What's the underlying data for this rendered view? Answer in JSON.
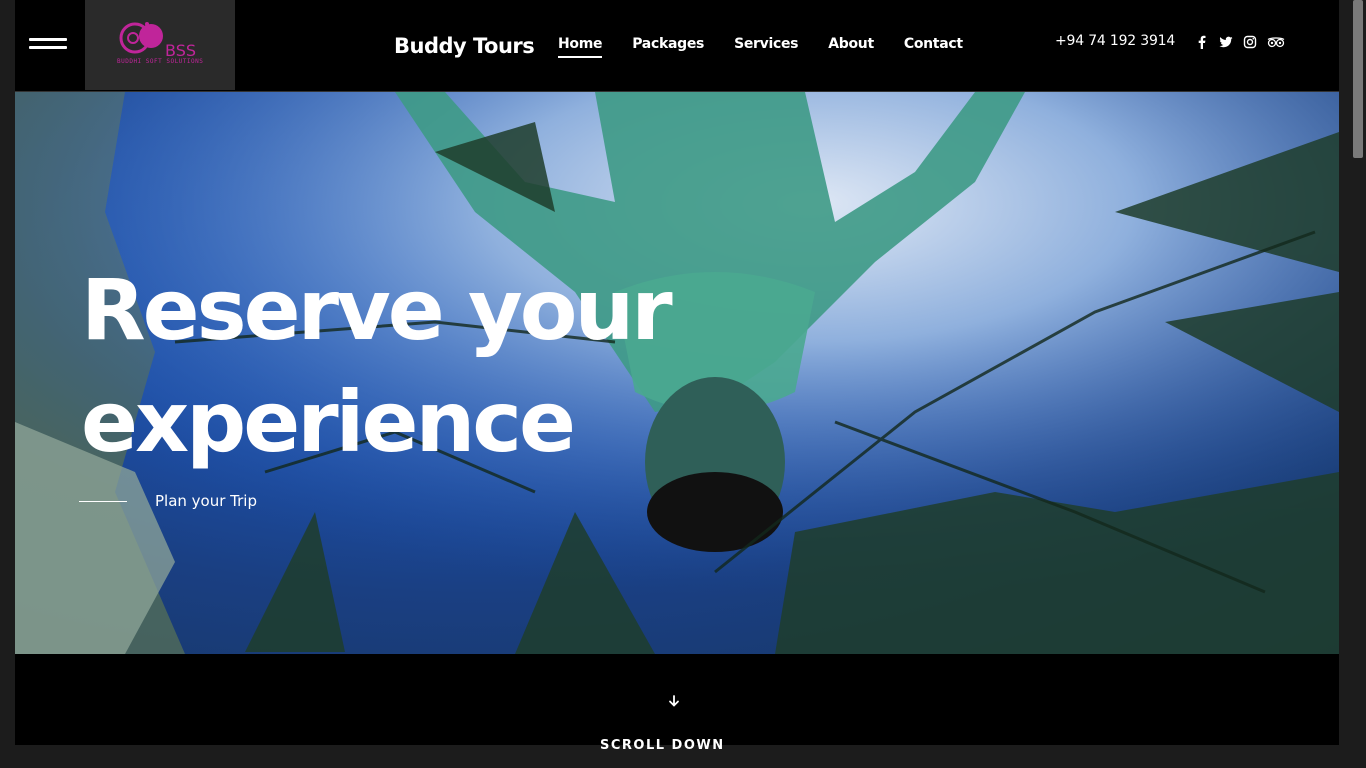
{
  "header": {
    "logo_text": "BSS",
    "logo_subtext": "BUDDHI SOFT SOLUTIONS",
    "brand": "Buddy Tours",
    "nav": [
      {
        "label": "Home",
        "active": true
      },
      {
        "label": "Packages",
        "active": false
      },
      {
        "label": "Services",
        "active": false
      },
      {
        "label": "About",
        "active": false
      },
      {
        "label": "Contact",
        "active": false
      }
    ],
    "phone": "+94 74 192 3914",
    "socials": [
      "facebook-icon",
      "twitter-icon",
      "instagram-icon",
      "tripadvisor-icon"
    ]
  },
  "hero": {
    "title_line1": "Reserve your",
    "title_line2": "experience",
    "cta_label": "Plan your Trip"
  },
  "footer_hint": {
    "scroll_label": "SCROLL DOWN"
  },
  "colors": {
    "accent_logo": "#c0259a",
    "background": "#000000"
  }
}
